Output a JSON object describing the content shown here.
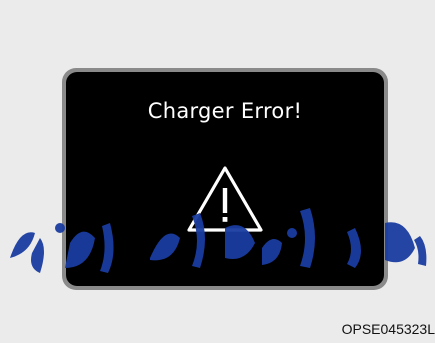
{
  "display": {
    "message": "Charger Error!",
    "icon": "warning-triangle-icon"
  },
  "figure_code": "OPSE045323L",
  "watermark": {
    "text": "مداد خودرو فارما",
    "color": "#1a3da0"
  },
  "colors": {
    "screen": "#000000",
    "frame": "#8a8a8a",
    "text": "#ffffff",
    "page": "#ebebeb"
  }
}
